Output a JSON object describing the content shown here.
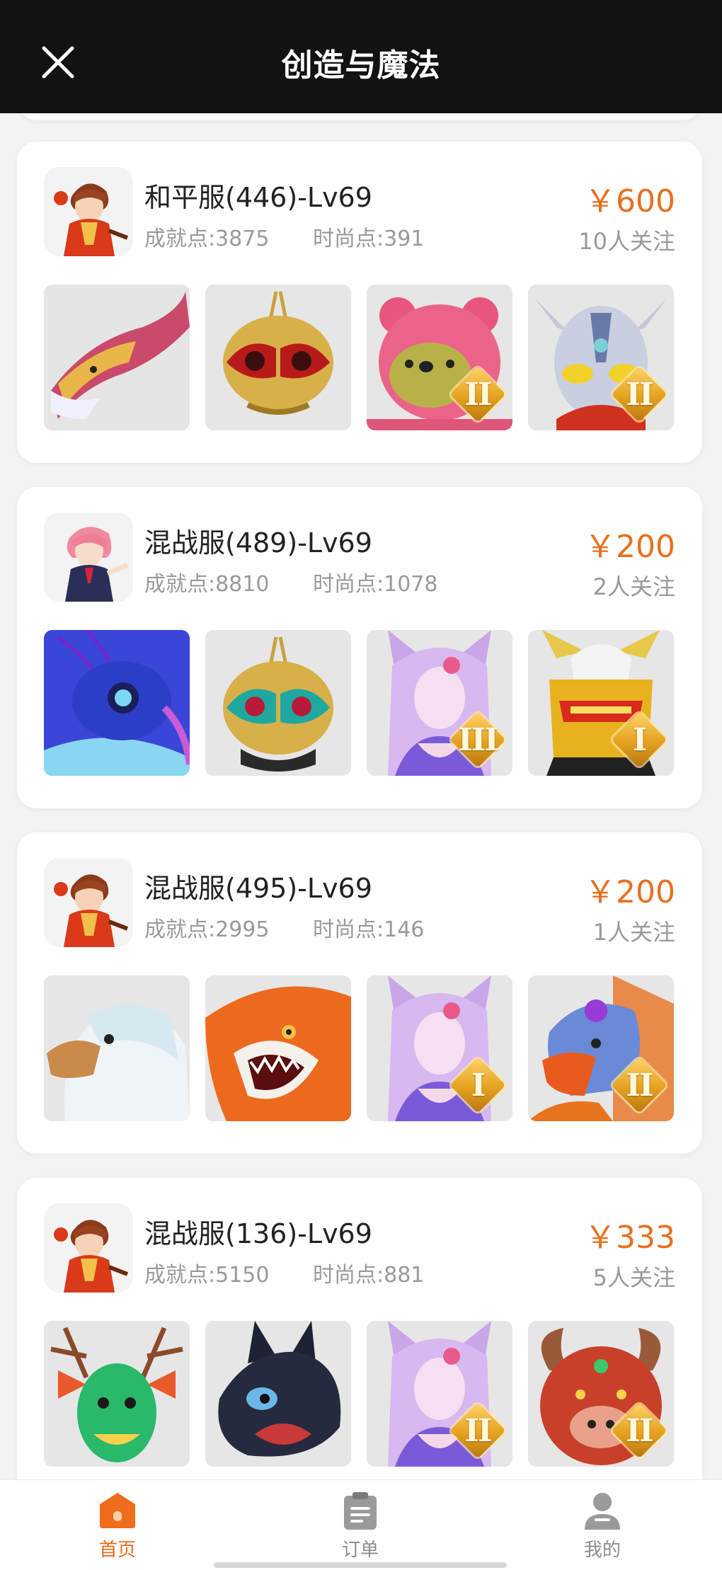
{
  "header": {
    "title": "创造与魔法",
    "close_icon": "close-icon"
  },
  "listings": [
    {
      "server": "和平服(446)-Lv69",
      "achievement": "成就点:3875",
      "fashion": "时尚点:391",
      "price": "￥600",
      "followers": "10人关注",
      "avatar": "boy-red-outfit",
      "items": [
        {
          "icon": "pink-dragon-mount",
          "badge": ""
        },
        {
          "icon": "gold-beetle-helmet",
          "badge": ""
        },
        {
          "icon": "pink-bear-pet",
          "badge": "II"
        },
        {
          "icon": "ultraman-mask",
          "badge": "II"
        }
      ]
    },
    {
      "server": "混战服(489)-Lv69",
      "achievement": "成就点:8810",
      "fashion": "时尚点:1078",
      "price": "￥200",
      "followers": "2人关注",
      "avatar": "girl-pink-hair",
      "items": [
        {
          "icon": "blue-bird-mount",
          "badge": ""
        },
        {
          "icon": "gold-teal-beetle-helmet",
          "badge": ""
        },
        {
          "icon": "fox-spirit-lady",
          "badge": "III"
        },
        {
          "icon": "gold-red-armor-helmet",
          "badge": "I"
        }
      ]
    },
    {
      "server": "混战服(495)-Lv69",
      "achievement": "成就点:2995",
      "fashion": "时尚点:146",
      "price": "￥200",
      "followers": "1人关注",
      "avatar": "boy-red-outfit",
      "items": [
        {
          "icon": "white-eagle",
          "badge": ""
        },
        {
          "icon": "orange-shark-fish",
          "badge": ""
        },
        {
          "icon": "fox-spirit-lady",
          "badge": "I"
        },
        {
          "icon": "blue-griffin",
          "badge": "II"
        }
      ]
    },
    {
      "server": "混战服(136)-Lv69",
      "achievement": "成就点:5150",
      "fashion": "时尚点:881",
      "price": "￥333",
      "followers": "5人关注",
      "avatar": "boy-red-outfit",
      "items": [
        {
          "icon": "green-antler-dragon",
          "badge": ""
        },
        {
          "icon": "black-cat-dragon",
          "badge": ""
        },
        {
          "icon": "fox-spirit-lady",
          "badge": "II"
        },
        {
          "icon": "red-horned-demon",
          "badge": "II"
        }
      ]
    }
  ],
  "nav": {
    "home": {
      "label": "首页",
      "icon": "home-icon",
      "active": true
    },
    "orders": {
      "label": "订单",
      "icon": "clipboard-icon",
      "active": false
    },
    "mine": {
      "label": "我的",
      "icon": "user-icon",
      "active": false
    }
  },
  "colors": {
    "accent": "#e8701e",
    "header_bg": "#121212",
    "page_bg": "#f3f3f3",
    "badge_gold": "#e4a21e"
  }
}
